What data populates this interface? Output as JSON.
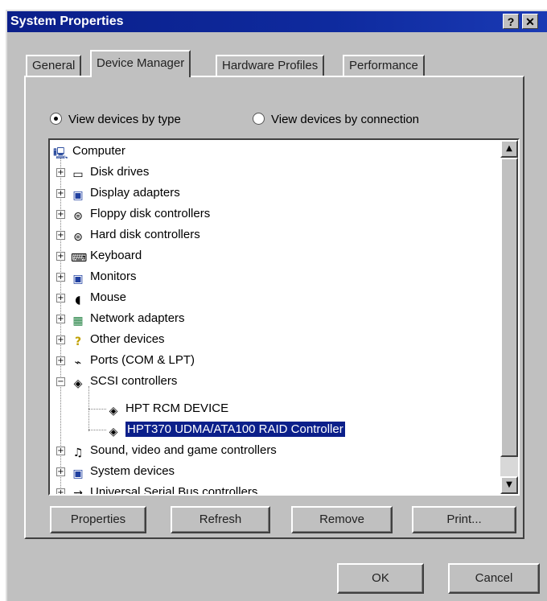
{
  "window": {
    "title": "System Properties",
    "help_glyph": "?",
    "close_glyph": "✕"
  },
  "tabs": [
    {
      "label": "General",
      "active": false
    },
    {
      "label": "Device Manager",
      "active": true
    },
    {
      "label": "Hardware Profiles",
      "active": false
    },
    {
      "label": "Performance",
      "active": false
    }
  ],
  "view_options": {
    "by_type": "View devices by type",
    "by_connection": "View devices by connection",
    "selected": "by_type"
  },
  "tree": {
    "root": {
      "label": "Computer",
      "icon": "computer-icon"
    },
    "items": [
      {
        "label": "Disk drives",
        "icon": "disk-drive-icon",
        "expander": "+"
      },
      {
        "label": "Display adapters",
        "icon": "display-adapter-icon",
        "expander": "+"
      },
      {
        "label": "Floppy disk controllers",
        "icon": "floppy-controller-icon",
        "expander": "+"
      },
      {
        "label": "Hard disk controllers",
        "icon": "hard-disk-controller-icon",
        "expander": "+"
      },
      {
        "label": "Keyboard",
        "icon": "keyboard-icon",
        "expander": "+"
      },
      {
        "label": "Monitors",
        "icon": "monitor-icon",
        "expander": "+"
      },
      {
        "label": "Mouse",
        "icon": "mouse-icon",
        "expander": "+"
      },
      {
        "label": "Network adapters",
        "icon": "network-adapter-icon",
        "expander": "+"
      },
      {
        "label": "Other devices",
        "icon": "question-icon",
        "expander": "+"
      },
      {
        "label": "Ports (COM & LPT)",
        "icon": "port-icon",
        "expander": "+"
      },
      {
        "label": "SCSI controllers",
        "icon": "scsi-icon",
        "expander": "−"
      },
      {
        "label": "Sound, video and game controllers",
        "icon": "sound-icon",
        "expander": "+"
      },
      {
        "label": "System devices",
        "icon": "system-devices-icon",
        "expander": "+"
      },
      {
        "label": "Universal Serial Bus controllers",
        "icon": "usb-icon",
        "expander": "+"
      }
    ],
    "scsi_children": [
      {
        "label": "HPT RCM DEVICE",
        "icon": "scsi-device-icon",
        "selected": false
      },
      {
        "label": "HPT370 UDMA/ATA100 RAID Controller",
        "icon": "scsi-device-icon",
        "selected": true
      }
    ]
  },
  "action_buttons": {
    "properties": "Properties",
    "refresh": "Refresh",
    "remove": "Remove",
    "print": "Print..."
  },
  "dialog_buttons": {
    "ok": "OK",
    "cancel": "Cancel"
  },
  "colors": {
    "titlebar": "#0b1f8a",
    "selection": "#0b1f8a",
    "face": "#c0c0c0"
  }
}
